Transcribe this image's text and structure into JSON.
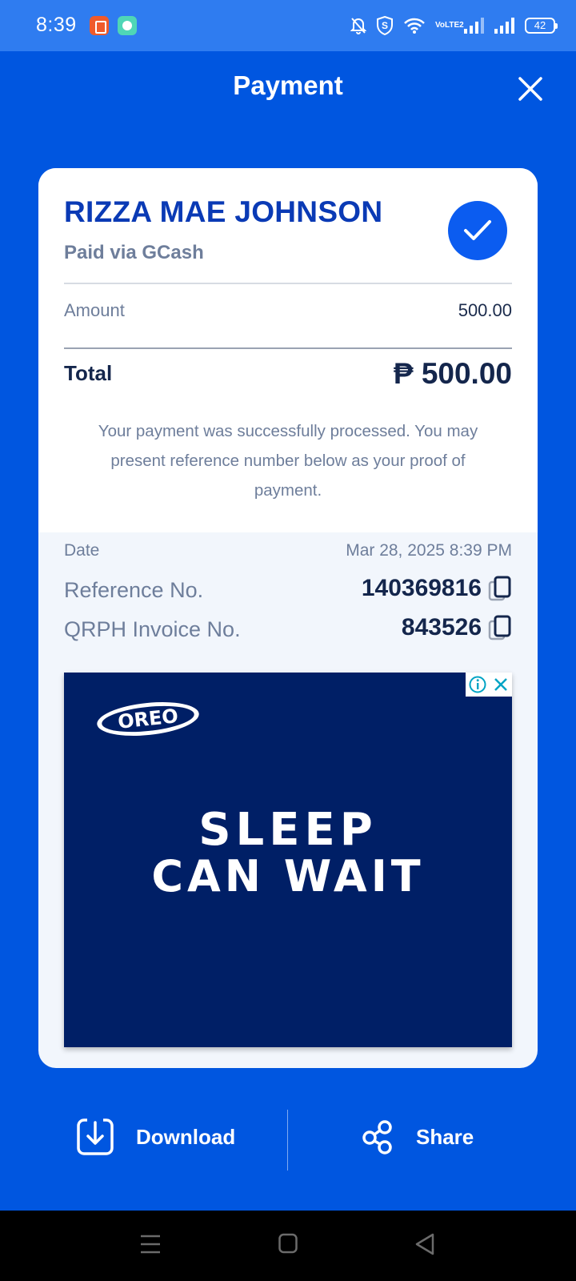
{
  "status_bar": {
    "time": "8:39",
    "battery": "42",
    "network": "VoLTE2",
    "icons": [
      "shopee-app-icon",
      "messenger-app-icon",
      "bell-muted-icon",
      "shield-icon",
      "wifi-icon",
      "signal-icon",
      "battery-icon"
    ]
  },
  "header": {
    "title": "Payment",
    "close_icon": "close-icon"
  },
  "receipt": {
    "payee_name": "RIZZA MAE JOHNSON",
    "paid_via": "Paid via GCash",
    "amount_label": "Amount",
    "amount_value": "500.00",
    "total_label": "Total",
    "total_value": "₱ 500.00",
    "message": "Your payment was successfully processed. You may present reference number below as your proof of payment.",
    "date_label": "Date",
    "date_value": "Mar 28, 2025 8:39 PM",
    "reference_label": "Reference No.",
    "reference_value": "140369816",
    "invoice_label": "QRPH Invoice No.",
    "invoice_value": "843526"
  },
  "ad": {
    "brand": "OREO",
    "headline_line1": "SLEEP",
    "headline_line2": "CAN WAIT",
    "background": "#001f66"
  },
  "actions": {
    "download_label": "Download",
    "share_label": "Share"
  },
  "colors": {
    "primary": "#0056e0",
    "status_bar": "#2f7cf0",
    "name_blue": "#0a3ab5",
    "text_dark": "#14264c",
    "text_muted": "#6e7e9b"
  }
}
